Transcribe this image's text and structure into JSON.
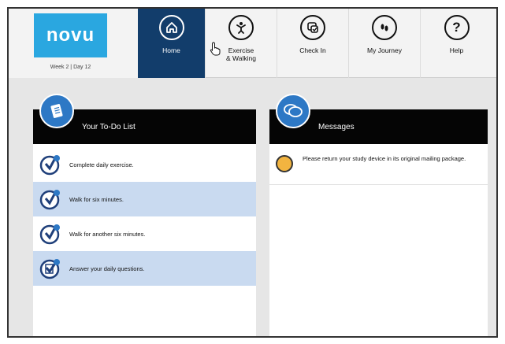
{
  "app": {
    "logo_text": "novu",
    "week_day": "Week 2 | Day 12"
  },
  "nav": {
    "tabs": [
      {
        "label": "Home",
        "icon": "home-icon",
        "active": true
      },
      {
        "label": "Exercise\n& Walking",
        "icon": "walking-figure-icon",
        "active": false
      },
      {
        "label": "Check In",
        "icon": "check-in-icon",
        "active": false
      },
      {
        "label": "My Journey",
        "icon": "footprints-icon",
        "active": false
      },
      {
        "label": "Help",
        "icon": "question-mark-icon",
        "active": false
      }
    ]
  },
  "todo": {
    "title": "Your To-Do List",
    "items": [
      {
        "label": "Complete daily exercise.",
        "icon": "exercise-checkmark-icon"
      },
      {
        "label": "Walk for six minutes.",
        "icon": "walk-checkmark-icon"
      },
      {
        "label": "Walk for another six minutes.",
        "icon": "walk-checkmark-icon"
      },
      {
        "label": "Answer your daily questions.",
        "icon": "questions-checkmark-icon"
      }
    ]
  },
  "messages": {
    "title": "Messages",
    "items": [
      {
        "text": "Please return your study device in its original mailing package.",
        "icon": "envelope-icon"
      }
    ]
  },
  "colors": {
    "brand_blue": "#2aa7e0",
    "nav_active": "#123d6b",
    "row_highlight": "#c9daf0",
    "header_black": "#050505"
  }
}
